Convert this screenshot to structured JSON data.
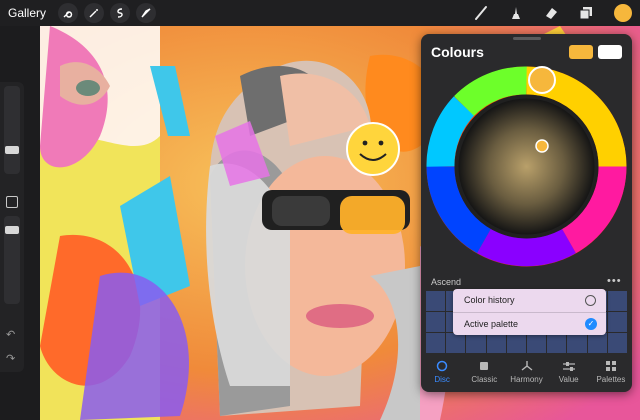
{
  "toolbar": {
    "gallery_label": "Gallery",
    "left_tools": [
      {
        "name": "actions-wrench-icon"
      },
      {
        "name": "adjustments-wand-icon"
      },
      {
        "name": "selection-icon"
      },
      {
        "name": "transform-arrow-icon"
      }
    ],
    "right_tools": [
      {
        "name": "brush-icon"
      },
      {
        "name": "smudge-icon"
      },
      {
        "name": "eraser-icon"
      },
      {
        "name": "layers-icon"
      }
    ],
    "current_color": "#f6b73c"
  },
  "sidebar": {
    "brush_size_icon": "slider-thumb",
    "opacity_icon": "slider-thumb",
    "modify_icon": "square-icon",
    "undo_icon": "undo-icon",
    "redo_icon": "redo-icon"
  },
  "colours_panel": {
    "title": "Colours",
    "primary_swatch": "#f6b73c",
    "secondary_swatch": "#ffffff",
    "palette_label": "Ascend",
    "more_label": "•••",
    "menu": {
      "color_history": "Color history",
      "active_palette": "Active palette",
      "active_selected": true
    },
    "tabs": [
      {
        "label": "Disc",
        "icon": "disc-icon",
        "active": true
      },
      {
        "label": "Classic",
        "icon": "classic-square-icon",
        "active": false
      },
      {
        "label": "Harmony",
        "icon": "harmony-icon",
        "active": false
      },
      {
        "label": "Value",
        "icon": "value-sliders-icon",
        "active": false
      },
      {
        "label": "Palettes",
        "icon": "palettes-grid-icon",
        "active": false
      }
    ]
  }
}
